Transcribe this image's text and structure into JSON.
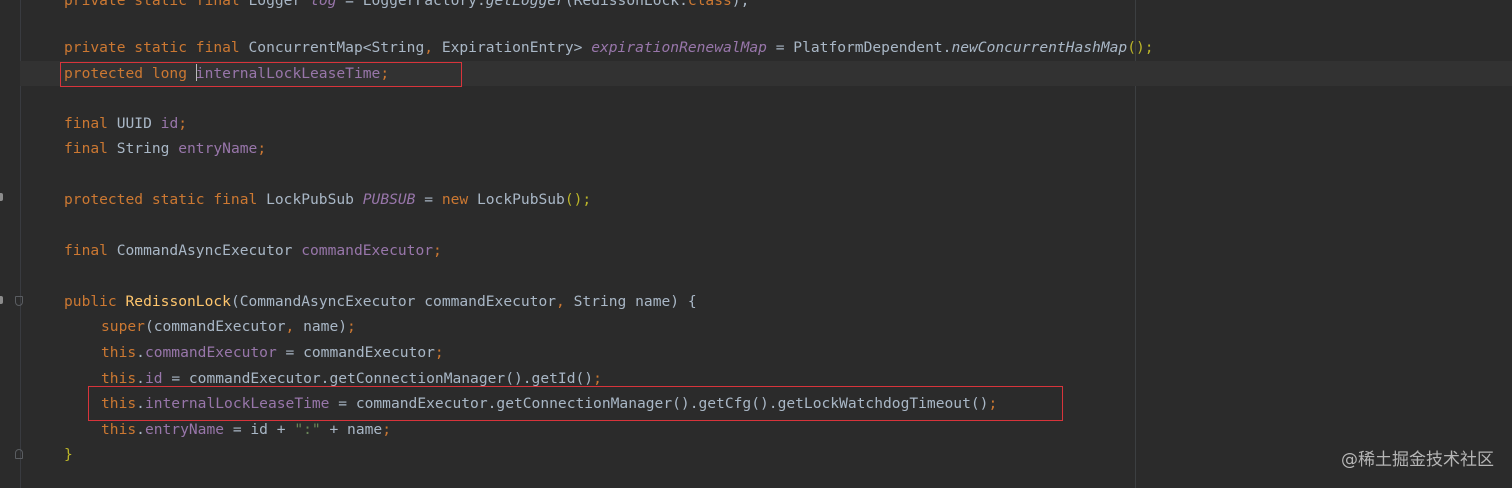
{
  "code": {
    "l0": {
      "a": "private static final ",
      "b": "Logger ",
      "c": "log",
      "d": " = LoggerFactory.",
      "e": "getLogger",
      "f": "(RedissonLock.",
      "g": "class",
      "h": ");"
    },
    "l1": {
      "a": "private static final ",
      "b": "ConcurrentMap<String",
      "c": ", ",
      "d": "ExpirationEntry> ",
      "e": "expirationRenewalMap",
      "f": " = PlatformDependent.",
      "g": "newConcurrentHashMap",
      "h": "();"
    },
    "l2": {
      "a": "protected long ",
      "b": "internalLockLeaseTime",
      "c": ";"
    },
    "l3": {
      "a": "final ",
      "b": "UUID ",
      "c": "id",
      "d": ";"
    },
    "l4": {
      "a": "final ",
      "b": "String ",
      "c": "entryName",
      "d": ";"
    },
    "l5": {
      "a": "protected static final ",
      "b": "LockPubSub ",
      "c": "PUBSUB",
      "d": " = ",
      "e": "new ",
      "f": "LockPubSub",
      "g": "();"
    },
    "l6": {
      "a": "final ",
      "b": "CommandAsyncExecutor ",
      "c": "commandExecutor",
      "d": ";"
    },
    "l7": {
      "a": "public ",
      "b": "RedissonLock",
      "c": "(CommandAsyncExecutor commandExecutor",
      "d": ", ",
      "e": "String name) {"
    },
    "l8": {
      "a": "super",
      "b": "(commandExecutor",
      "c": ", ",
      "d": "name)",
      "e": ";"
    },
    "l9": {
      "a": "this",
      "b": ".",
      "c": "commandExecutor",
      "d": " = commandExecutor",
      "e": ";"
    },
    "l10": {
      "a": "this",
      "b": ".",
      "c": "id",
      "d": " = commandExecutor.getConnectionManager().getId()",
      "e": ";"
    },
    "l11": {
      "a": "this",
      "b": ".",
      "c": "internalLockLeaseTime",
      "d": " = commandExecutor.getConnectionManager().getCfg().getLockWatchdogTimeout()",
      "e": ";"
    },
    "l12": {
      "a": "this",
      "b": ".",
      "c": "entryName",
      "d": " = id + ",
      "e": "\":\"",
      "f": " + name",
      "g": ";"
    },
    "l13": {
      "a": "}"
    }
  },
  "watermark": "@稀土掘金技术社区",
  "colors": {
    "background": "#2b2b2b",
    "keyword": "#cc7832",
    "field": "#9876aa",
    "method": "#ffc66d",
    "string": "#6a8759",
    "highlight_box": "#d8343b"
  }
}
